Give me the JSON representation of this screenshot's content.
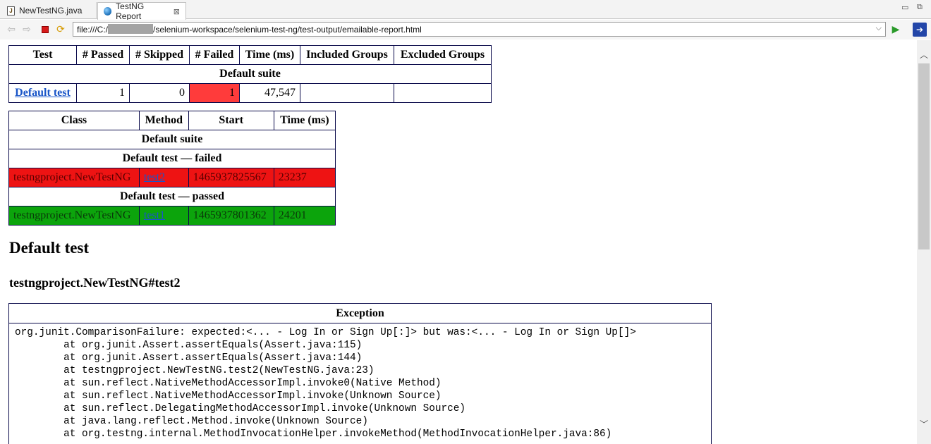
{
  "tabs": [
    {
      "label": "NewTestNG.java",
      "icon": "java-file-icon"
    },
    {
      "label": "TestNG Report",
      "icon": "globe-icon",
      "close": "⊠"
    }
  ],
  "address_bar": {
    "prefix": "file:///C:/",
    "suffix": "/selenium-workspace/selenium-test-ng/test-output/emailable-report.html"
  },
  "summary_table": {
    "headers": [
      "Test",
      "# Passed",
      "# Skipped",
      "# Failed",
      "Time (ms)",
      "Included Groups",
      "Excluded Groups"
    ],
    "suite_label": "Default suite",
    "row": {
      "test": "Default test",
      "passed": "1",
      "skipped": "0",
      "failed": "1",
      "time": "47,547",
      "included": "",
      "excluded": ""
    }
  },
  "methods_table": {
    "headers": [
      "Class",
      "Method",
      "Start",
      "Time (ms)"
    ],
    "suite_label": "Default suite",
    "failed_label": "Default test — failed",
    "failed_row": {
      "class": "testngproject.NewTestNG",
      "method": "test2",
      "start": "1465937825567",
      "time": "23237"
    },
    "passed_label": "Default test — passed",
    "passed_row": {
      "class": "testngproject.NewTestNG",
      "method": "test1",
      "start": "1465937801362",
      "time": "24201"
    }
  },
  "section_title": "Default test",
  "method_title": "testngproject.NewTestNG#test2",
  "exception": {
    "header": "Exception",
    "lines": [
      "org.junit.ComparisonFailure: expected:<... - Log In or Sign Up[:]> but was:<... - Log In or Sign Up[]>",
      "\tat org.junit.Assert.assertEquals(Assert.java:115)",
      "\tat org.junit.Assert.assertEquals(Assert.java:144)",
      "\tat testngproject.NewTestNG.test2(NewTestNG.java:23)",
      "\tat sun.reflect.NativeMethodAccessorImpl.invoke0(Native Method)",
      "\tat sun.reflect.NativeMethodAccessorImpl.invoke(Unknown Source)",
      "\tat sun.reflect.DelegatingMethodAccessorImpl.invoke(Unknown Source)",
      "\tat java.lang.reflect.Method.invoke(Unknown Source)",
      "\tat org.testng.internal.MethodInvocationHelper.invokeMethod(MethodInvocationHelper.java:86)"
    ]
  },
  "colors": {
    "fail": "#ee1313",
    "pass": "#0ca40c",
    "fail_cell": "#ff3b3b",
    "link": "#1a56c8",
    "border": "#09094a"
  }
}
